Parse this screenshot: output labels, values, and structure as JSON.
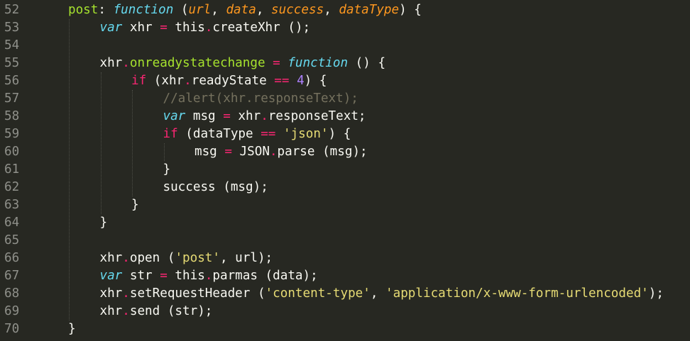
{
  "colors": {
    "background": "#272822",
    "plain": "#f8f8f2",
    "function_name": "#a6e22e",
    "keyword": "#66d9ef",
    "parameter": "#fd971f",
    "operator": "#f92672",
    "number": "#ae81ff",
    "string": "#e6db74",
    "comment": "#75715e",
    "line_number": "#8f908a"
  },
  "lines": [
    {
      "num": "52",
      "indent": 0,
      "tokens": [
        {
          "t": "fn",
          "v": "post"
        },
        {
          "t": "plain",
          "v": ": "
        },
        {
          "t": "kw",
          "v": "function"
        },
        {
          "t": "plain",
          "v": " ("
        },
        {
          "t": "param",
          "v": "url"
        },
        {
          "t": "plain",
          "v": ", "
        },
        {
          "t": "param",
          "v": "data"
        },
        {
          "t": "plain",
          "v": ", "
        },
        {
          "t": "param",
          "v": "success"
        },
        {
          "t": "plain",
          "v": ", "
        },
        {
          "t": "param",
          "v": "dataType"
        },
        {
          "t": "plain",
          "v": ") {"
        }
      ]
    },
    {
      "num": "53",
      "indent": 1,
      "tokens": [
        {
          "t": "kw",
          "v": "var"
        },
        {
          "t": "plain",
          "v": " xhr "
        },
        {
          "t": "op",
          "v": "="
        },
        {
          "t": "plain",
          "v": " this"
        },
        {
          "t": "op",
          "v": "."
        },
        {
          "t": "plain",
          "v": "createXhr ();"
        }
      ]
    },
    {
      "num": "54",
      "indent": 1,
      "tokens": []
    },
    {
      "num": "55",
      "indent": 1,
      "tokens": [
        {
          "t": "plain",
          "v": "xhr"
        },
        {
          "t": "op",
          "v": "."
        },
        {
          "t": "fn",
          "v": "onreadystatechange"
        },
        {
          "t": "plain",
          "v": " "
        },
        {
          "t": "op",
          "v": "="
        },
        {
          "t": "plain",
          "v": " "
        },
        {
          "t": "kw",
          "v": "function"
        },
        {
          "t": "plain",
          "v": " () {"
        }
      ]
    },
    {
      "num": "56",
      "indent": 2,
      "tokens": [
        {
          "t": "op",
          "v": "if"
        },
        {
          "t": "plain",
          "v": " (xhr"
        },
        {
          "t": "op",
          "v": "."
        },
        {
          "t": "plain",
          "v": "readyState "
        },
        {
          "t": "op",
          "v": "=="
        },
        {
          "t": "plain",
          "v": " "
        },
        {
          "t": "num",
          "v": "4"
        },
        {
          "t": "plain",
          "v": ") {"
        }
      ]
    },
    {
      "num": "57",
      "indent": 3,
      "tokens": [
        {
          "t": "cmt",
          "v": "//alert(xhr.responseText);"
        }
      ]
    },
    {
      "num": "58",
      "indent": 3,
      "tokens": [
        {
          "t": "kw",
          "v": "var"
        },
        {
          "t": "plain",
          "v": " msg "
        },
        {
          "t": "op",
          "v": "="
        },
        {
          "t": "plain",
          "v": " xhr"
        },
        {
          "t": "op",
          "v": "."
        },
        {
          "t": "plain",
          "v": "responseText;"
        }
      ]
    },
    {
      "num": "59",
      "indent": 3,
      "tokens": [
        {
          "t": "op",
          "v": "if"
        },
        {
          "t": "plain",
          "v": " (dataType "
        },
        {
          "t": "op",
          "v": "=="
        },
        {
          "t": "plain",
          "v": " "
        },
        {
          "t": "str",
          "v": "'json'"
        },
        {
          "t": "plain",
          "v": ") {"
        }
      ]
    },
    {
      "num": "60",
      "indent": 4,
      "tokens": [
        {
          "t": "plain",
          "v": "msg "
        },
        {
          "t": "op",
          "v": "="
        },
        {
          "t": "plain",
          "v": " JSON"
        },
        {
          "t": "op",
          "v": "."
        },
        {
          "t": "plain",
          "v": "parse (msg);"
        }
      ]
    },
    {
      "num": "61",
      "indent": 3,
      "tokens": [
        {
          "t": "plain",
          "v": "}"
        }
      ]
    },
    {
      "num": "62",
      "indent": 3,
      "tokens": [
        {
          "t": "plain",
          "v": "success (msg);"
        }
      ]
    },
    {
      "num": "63",
      "indent": 2,
      "tokens": [
        {
          "t": "plain",
          "v": "}"
        }
      ]
    },
    {
      "num": "64",
      "indent": 1,
      "tokens": [
        {
          "t": "plain",
          "v": "}"
        }
      ]
    },
    {
      "num": "65",
      "indent": 1,
      "tokens": []
    },
    {
      "num": "66",
      "indent": 1,
      "tokens": [
        {
          "t": "plain",
          "v": "xhr"
        },
        {
          "t": "op",
          "v": "."
        },
        {
          "t": "plain",
          "v": "open ("
        },
        {
          "t": "str",
          "v": "'post'"
        },
        {
          "t": "plain",
          "v": ", url);"
        }
      ]
    },
    {
      "num": "67",
      "indent": 1,
      "tokens": [
        {
          "t": "kw",
          "v": "var"
        },
        {
          "t": "plain",
          "v": " str "
        },
        {
          "t": "op",
          "v": "="
        },
        {
          "t": "plain",
          "v": " this"
        },
        {
          "t": "op",
          "v": "."
        },
        {
          "t": "plain",
          "v": "parmas (data);"
        }
      ]
    },
    {
      "num": "68",
      "indent": 1,
      "tokens": [
        {
          "t": "plain",
          "v": "xhr"
        },
        {
          "t": "op",
          "v": "."
        },
        {
          "t": "plain",
          "v": "setRequestHeader ("
        },
        {
          "t": "str",
          "v": "'content-type'"
        },
        {
          "t": "plain",
          "v": ", "
        },
        {
          "t": "str",
          "v": "'application/x-www-form-urlencoded'"
        },
        {
          "t": "plain",
          "v": ");"
        }
      ]
    },
    {
      "num": "69",
      "indent": 1,
      "tokens": [
        {
          "t": "plain",
          "v": "xhr"
        },
        {
          "t": "op",
          "v": "."
        },
        {
          "t": "plain",
          "v": "send (str);"
        }
      ]
    },
    {
      "num": "70",
      "indent": 0,
      "tokens": [
        {
          "t": "plain",
          "v": "}"
        }
      ]
    }
  ]
}
